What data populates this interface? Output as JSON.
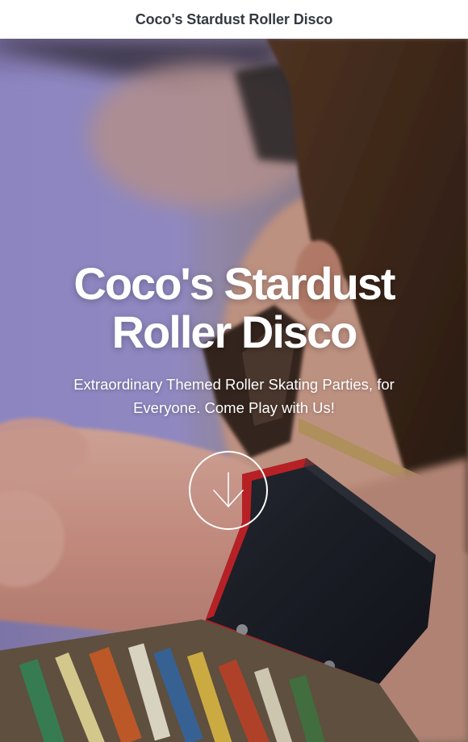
{
  "header": {
    "site_title": "Coco's Stardust Roller Disco"
  },
  "hero": {
    "heading": "Coco's Stardust Roller Disco",
    "tagline": "Extraordinary Themed Roller Skating Parties, for Everyone. Come Play with Us!",
    "scroll_icon": "arrow-down-icon"
  }
}
